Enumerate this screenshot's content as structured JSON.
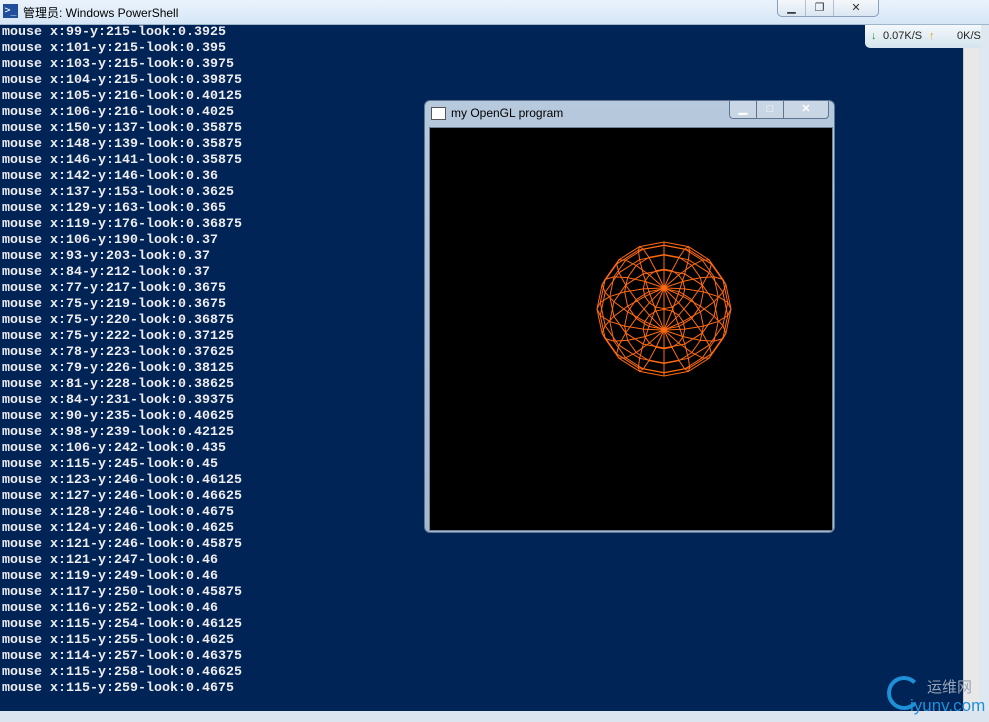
{
  "window": {
    "title": "管理员: Windows PowerShell",
    "icon": "powershell-icon",
    "buttons": {
      "minimize": "▁",
      "restore": "❐",
      "close": "✕"
    }
  },
  "console_lines": [
    "mouse x:99-y:215-look:0.3925",
    "mouse x:101-y:215-look:0.395",
    "mouse x:103-y:215-look:0.3975",
    "mouse x:104-y:215-look:0.39875",
    "mouse x:105-y:216-look:0.40125",
    "mouse x:106-y:216-look:0.4025",
    "mouse x:150-y:137-look:0.35875",
    "mouse x:148-y:139-look:0.35875",
    "mouse x:146-y:141-look:0.35875",
    "mouse x:142-y:146-look:0.36",
    "mouse x:137-y:153-look:0.3625",
    "mouse x:129-y:163-look:0.365",
    "mouse x:119-y:176-look:0.36875",
    "mouse x:106-y:190-look:0.37",
    "mouse x:93-y:203-look:0.37",
    "mouse x:84-y:212-look:0.37",
    "mouse x:77-y:217-look:0.3675",
    "mouse x:75-y:219-look:0.3675",
    "mouse x:75-y:220-look:0.36875",
    "mouse x:75-y:222-look:0.37125",
    "mouse x:78-y:223-look:0.37625",
    "mouse x:79-y:226-look:0.38125",
    "mouse x:81-y:228-look:0.38625",
    "mouse x:84-y:231-look:0.39375",
    "mouse x:90-y:235-look:0.40625",
    "mouse x:98-y:239-look:0.42125",
    "mouse x:106-y:242-look:0.435",
    "mouse x:115-y:245-look:0.45",
    "mouse x:123-y:246-look:0.46125",
    "mouse x:127-y:246-look:0.46625",
    "mouse x:128-y:246-look:0.4675",
    "mouse x:124-y:246-look:0.4625",
    "mouse x:121-y:246-look:0.45875",
    "mouse x:121-y:247-look:0.46",
    "mouse x:119-y:249-look:0.46",
    "mouse x:117-y:250-look:0.45875",
    "mouse x:116-y:252-look:0.46",
    "mouse x:115-y:254-look:0.46125",
    "mouse x:115-y:255-look:0.4625",
    "mouse x:114-y:257-look:0.46375",
    "mouse x:115-y:258-look:0.46625",
    "mouse x:115-y:259-look:0.4675"
  ],
  "net_monitor": {
    "down_arrow": "↓",
    "down": "0.07K/S",
    "up_arrow": "↑",
    "up": "0K/S"
  },
  "gl_window": {
    "title": "my  OpenGL program",
    "buttons": {
      "minimize": "▁",
      "maximize": "□",
      "close": "✕"
    },
    "wire_color": "#ff6a10"
  },
  "watermark": {
    "cn": "运维网",
    "en": "iyunv.com"
  }
}
